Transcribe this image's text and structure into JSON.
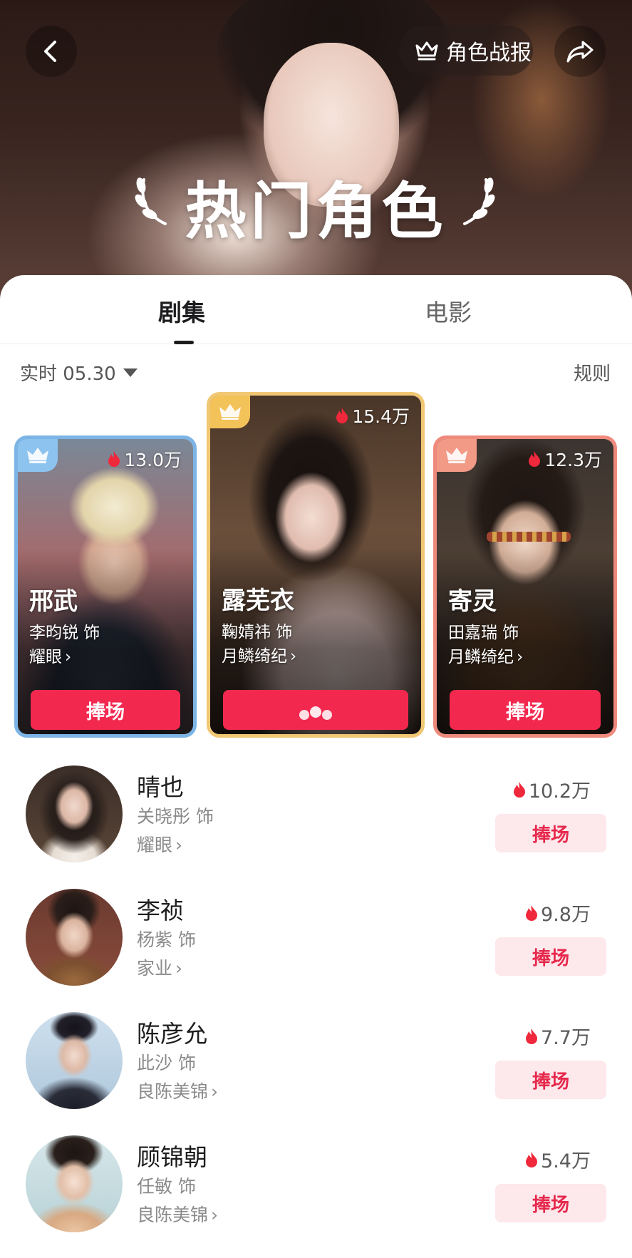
{
  "header": {
    "title": "热门角色",
    "report_label": "角色战报"
  },
  "tabs": [
    {
      "label": "剧集",
      "active": true
    },
    {
      "label": "电影",
      "active": false
    }
  ],
  "filter": {
    "label": "实时 05.30",
    "rules_label": "规则"
  },
  "podium": [
    {
      "rank": 2,
      "name": "邢武",
      "actor": "李昀锐 饰",
      "show": "耀眼",
      "heat": "13.0万",
      "button": "捧场",
      "frame_color": "#7cb4e6"
    },
    {
      "rank": 1,
      "name": "露芜衣",
      "actor": "鞠婧祎 饰",
      "show": "月鳞绮纪",
      "heat": "15.4万",
      "button": "",
      "frame_color": "#f1c774"
    },
    {
      "rank": 3,
      "name": "寄灵",
      "actor": "田嘉瑞 饰",
      "show": "月鳞绮纪",
      "heat": "12.3万",
      "button": "捧场",
      "frame_color": "#ee8a7c"
    }
  ],
  "list": [
    {
      "name": "晴也",
      "actor": "关晓彤 饰",
      "show": "耀眼",
      "heat": "10.2万",
      "button": "捧场"
    },
    {
      "name": "李祯",
      "actor": "杨紫 饰",
      "show": "家业",
      "heat": "9.8万",
      "button": "捧场"
    },
    {
      "name": "陈彦允",
      "actor": "此沙 饰",
      "show": "良陈美锦",
      "heat": "7.7万",
      "button": "捧场"
    },
    {
      "name": "顾锦朝",
      "actor": "任敏 饰",
      "show": "良陈美锦",
      "heat": "5.4万",
      "button": "捧场"
    }
  ],
  "colors": {
    "accent": "#f3284f",
    "accent_light": "#fde8ec",
    "flame": "#f0283c"
  }
}
